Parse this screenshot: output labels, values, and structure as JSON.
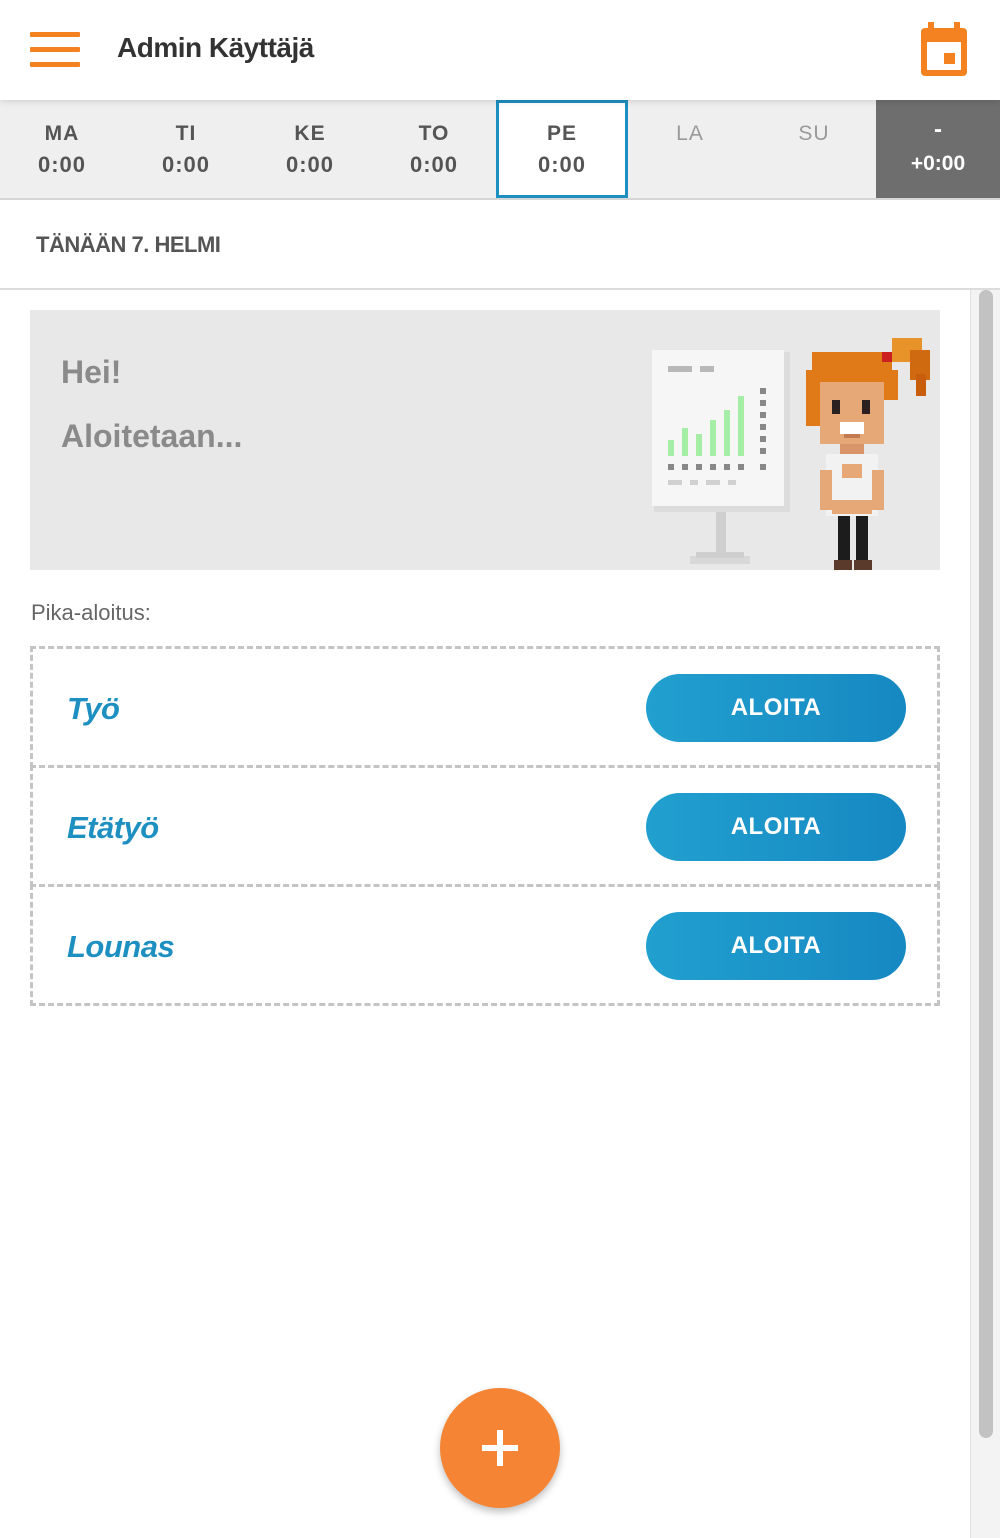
{
  "header": {
    "title": "Admin Käyttäjä",
    "menu_icon": "hamburger-menu-icon",
    "calendar_icon": "calendar-icon",
    "accent_color": "#f58220"
  },
  "week": {
    "days": [
      {
        "label": "MA",
        "hours": "0:00",
        "active": false,
        "enabled": true
      },
      {
        "label": "TI",
        "hours": "0:00",
        "active": false,
        "enabled": true
      },
      {
        "label": "KE",
        "hours": "0:00",
        "active": false,
        "enabled": true
      },
      {
        "label": "TO",
        "hours": "0:00",
        "active": false,
        "enabled": true
      },
      {
        "label": "PE",
        "hours": "0:00",
        "active": true,
        "enabled": true
      },
      {
        "label": "LA",
        "hours": "",
        "active": false,
        "enabled": false
      },
      {
        "label": "SU",
        "hours": "",
        "active": false,
        "enabled": false
      }
    ],
    "total_dash": "-",
    "total": "+0:00",
    "active_color": "#1d8fc1"
  },
  "today": {
    "label": "TÄNÄÄN 7. HELMI"
  },
  "hero": {
    "greeting": "Hei!",
    "subtitle": "Aloitetaan..."
  },
  "quick_start": {
    "label": "Pika-aloitus:",
    "items": [
      {
        "name": "Työ",
        "button": "ALOITA"
      },
      {
        "name": "Etätyö",
        "button": "ALOITA"
      },
      {
        "name": "Lounas",
        "button": "ALOITA"
      }
    ]
  },
  "fab": {
    "icon": "plus-icon",
    "color": "#f58434"
  }
}
